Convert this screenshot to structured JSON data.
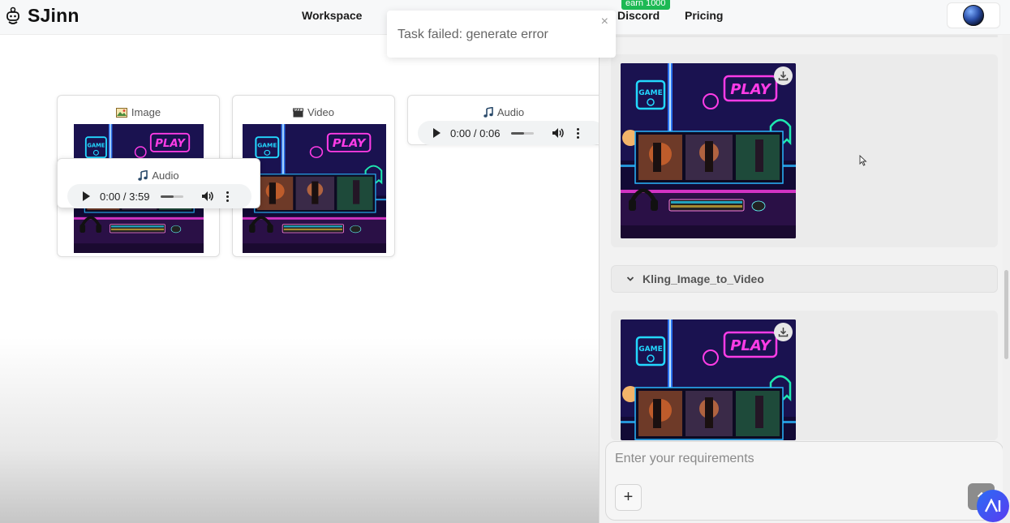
{
  "header": {
    "app_name": "SJinn",
    "nav": {
      "workspace": "Workspace",
      "discord": "Discord",
      "pricing": "Pricing"
    },
    "earn_badge": "earn 1000"
  },
  "toast": {
    "message": "Task failed: generate error",
    "close": "×"
  },
  "canvas": {
    "image_node": {
      "title": "Image",
      "icon": "image-icon"
    },
    "video_node": {
      "title": "Video",
      "icon": "clapperboard-icon"
    },
    "audio_node_right": {
      "title": "Audio",
      "icon": "music-note-icon",
      "time": "0:00 / 0:06",
      "progress": 0.0
    },
    "audio_node_overlay": {
      "title": "Audio",
      "icon": "music-note-icon",
      "time": "0:00 / 3:59",
      "progress": 0.0
    }
  },
  "panel": {
    "step_label": "Kling_Image_to_Video",
    "input_placeholder": "Enter your requirements",
    "plus_label": "+",
    "send_icon": "arrow-up-icon",
    "download_icon": "download-icon"
  },
  "colors": {
    "accent_green": "#1db954",
    "neon_pink": "#ff3ce6",
    "neon_cyan": "#23d8ff",
    "neon_teal": "#1fe8b0"
  }
}
